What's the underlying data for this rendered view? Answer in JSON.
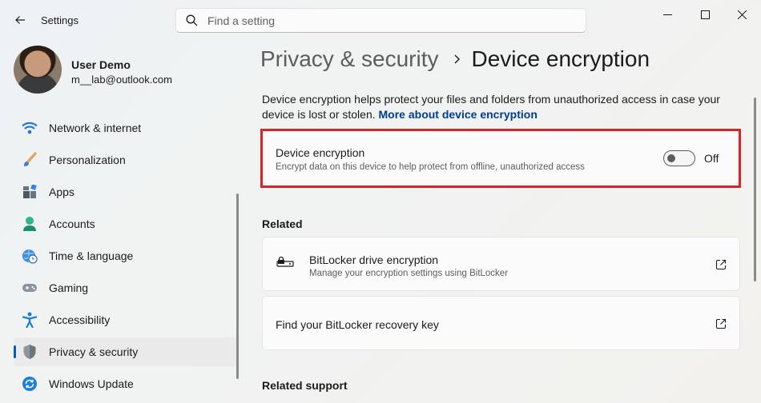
{
  "window": {
    "app_title": "Settings",
    "controls": [
      "minimize-icon",
      "maximize-icon",
      "close-icon"
    ]
  },
  "search": {
    "placeholder": "Find a setting",
    "icon": "search-icon"
  },
  "profile": {
    "name": "User Demo",
    "email": "m__lab@outlook.com"
  },
  "sidebar": {
    "items": [
      {
        "label": "Network & internet",
        "icon": "wifi-icon",
        "active": false
      },
      {
        "label": "Personalization",
        "icon": "brush-icon",
        "active": false
      },
      {
        "label": "Apps",
        "icon": "apps-icon",
        "active": false
      },
      {
        "label": "Accounts",
        "icon": "person-icon",
        "active": false
      },
      {
        "label": "Time & language",
        "icon": "globe-clock-icon",
        "active": false
      },
      {
        "label": "Gaming",
        "icon": "gamepad-icon",
        "active": false
      },
      {
        "label": "Accessibility",
        "icon": "accessibility-icon",
        "active": false
      },
      {
        "label": "Privacy & security",
        "icon": "shield-icon",
        "active": true
      },
      {
        "label": "Windows Update",
        "icon": "update-icon",
        "active": false
      }
    ]
  },
  "breadcrumb": {
    "parent": "Privacy & security",
    "current": "Device encryption"
  },
  "description": {
    "text": "Device encryption helps protect your files and folders from unauthorized access in case your device is lost or stolen.",
    "link": "More about device encryption"
  },
  "device_encryption": {
    "title": "Device encryption",
    "subtitle": "Encrypt data on this device to help protect from offline, unauthorized access",
    "toggle_state": "Off",
    "enabled": false
  },
  "related": {
    "heading": "Related",
    "items": [
      {
        "title": "BitLocker drive encryption",
        "subtitle": "Manage your encryption settings using BitLocker",
        "icon": "bitlocker-drive-icon"
      },
      {
        "title": "Find your BitLocker recovery key"
      }
    ]
  },
  "related_support": {
    "heading": "Related support"
  },
  "colors": {
    "accent": "#005fb8",
    "highlight": "#d0262e",
    "link": "#003e92"
  }
}
